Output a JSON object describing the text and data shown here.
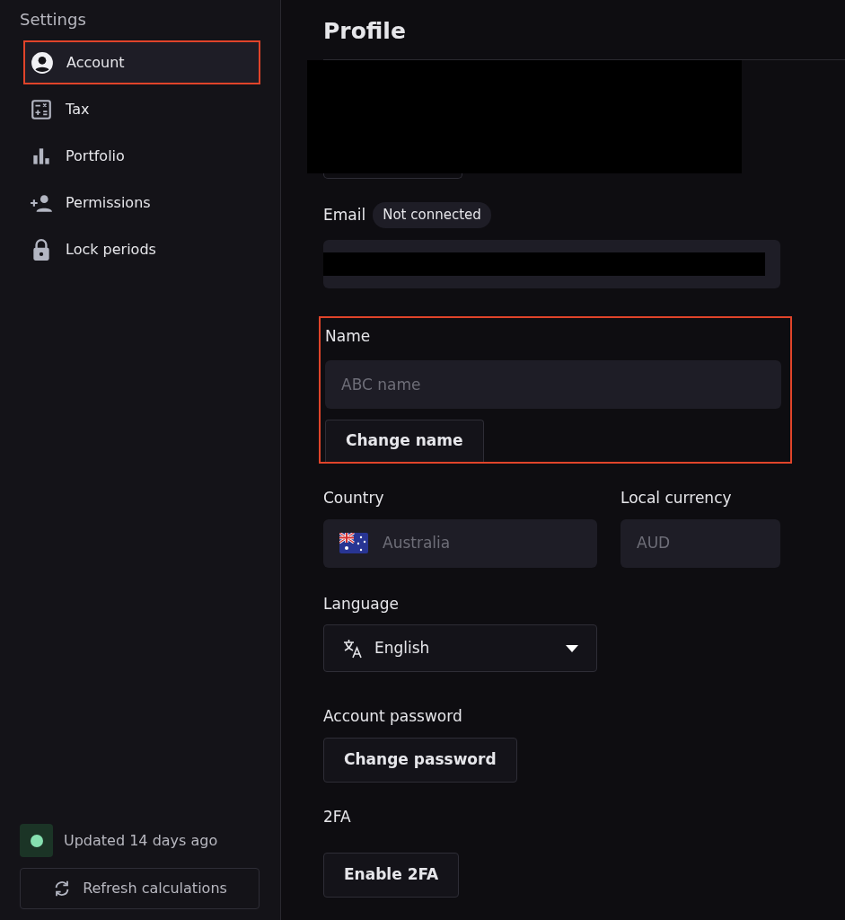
{
  "sidebar": {
    "title": "Settings",
    "items": [
      {
        "label": "Account",
        "selected": true,
        "highlighted": true
      },
      {
        "label": "Tax",
        "selected": false,
        "highlighted": false
      },
      {
        "label": "Portfolio",
        "selected": false,
        "highlighted": false
      },
      {
        "label": "Permissions",
        "selected": false,
        "highlighted": false
      },
      {
        "label": "Lock periods",
        "selected": false,
        "highlighted": false
      }
    ],
    "status": {
      "text": "Updated 14 days ago",
      "color": "#86e0b0"
    },
    "refresh_button": "Refresh calculations"
  },
  "main": {
    "title": "Profile",
    "redacted_top": true,
    "email": {
      "label": "Email",
      "badge": "Not connected",
      "redacted": true
    },
    "name": {
      "label": "Name",
      "placeholder": "ABC name",
      "button": "Change name",
      "highlighted": true
    },
    "country": {
      "label": "Country",
      "value": "Australia",
      "disabled": true
    },
    "currency": {
      "label": "Local currency",
      "value": "AUD",
      "disabled": true
    },
    "language": {
      "label": "Language",
      "value": "English"
    },
    "password": {
      "label": "Account password",
      "button": "Change password"
    },
    "twofa": {
      "label": "2FA",
      "button": "Enable 2FA"
    }
  }
}
